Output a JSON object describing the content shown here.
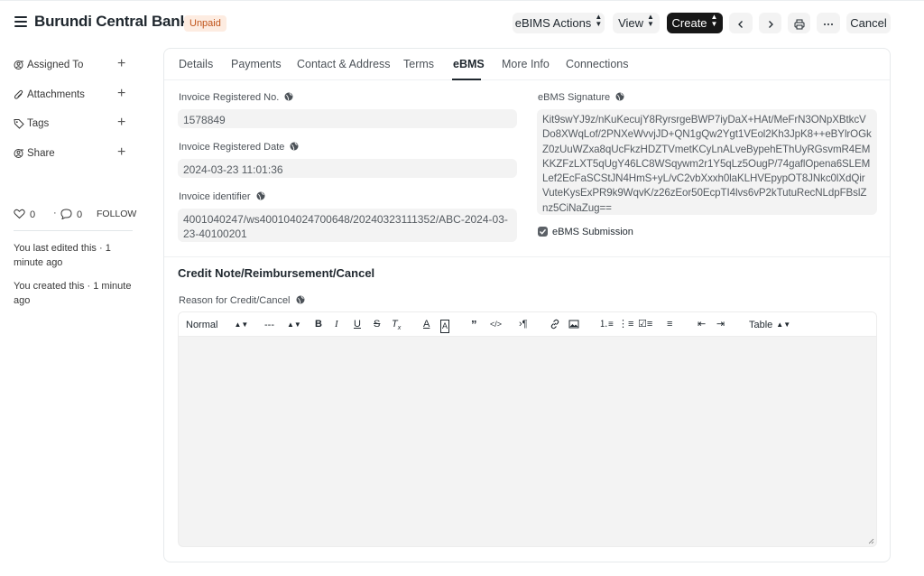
{
  "header": {
    "title": "Burundi Central Bank",
    "status": "Unpaid",
    "buttons": {
      "ebims_actions": "eBIMS Actions",
      "view": "View",
      "create": "Create",
      "cancel": "Cancel"
    }
  },
  "sidebar": {
    "items": [
      {
        "label": "Assigned To",
        "icon": "assign-icon"
      },
      {
        "label": "Attachments",
        "icon": "attachment-icon"
      },
      {
        "label": "Tags",
        "icon": "tag-icon"
      },
      {
        "label": "Share",
        "icon": "share-icon"
      }
    ],
    "likes": "0",
    "comments": "0",
    "follow": "FOLLOW",
    "activity": [
      "You last edited this · 1 minute ago",
      "You created this · 1 minute ago"
    ]
  },
  "tabs": [
    "Details",
    "Payments",
    "Contact & Address",
    "Terms",
    "eBMS",
    "More Info",
    "Connections"
  ],
  "active_tab": "eBMS",
  "fields": {
    "invoice_registered_no": {
      "label": "Invoice Registered No.",
      "value": "1578849"
    },
    "invoice_registered_date": {
      "label": "Invoice Registered Date",
      "value": "2024-03-23 11:01:36"
    },
    "invoice_identifier": {
      "label": "Invoice identifier",
      "value": "4001040247/ws400104024700648/20240323111352/ABC-2024-03-23-40100201"
    },
    "ebms_signature": {
      "label": "eBMS Signature",
      "value": "Kit9swYJ9z/nKuKecujY8RyrsrgeBWP7iyDaX+HAt/MeFrN3ONpXBtkcVDo8XWqLof/2PNXeWvvjJD+QN1gQw2Ygt1VEol2Kh3JpK8++eBYlrOGkZ0zUuWZxa8qUcFkzHDZTVmetKCyLnALveBypehEThUyRGsvmR4EMKKZFzLXT5qUgY46LC8WSqywm2r1Y5qLz5OugP/74gaflOpena6SLEMLef2EcFaSCStJN4HmS+yL/vC2vbXxxh0laKLHVEpypOT8JNkc0lXdQirVuteKysExPR9k9WqvK/z26zEor50EcpTI4lvs6vP2kTutuRecNLdpFBslZnz5CiNaZug=="
    },
    "ebms_submission": {
      "label": "eBMS Submission",
      "checked": true
    }
  },
  "section": {
    "title": "Credit Note/Reimbursement/Cancel",
    "reason_label": "Reason for Credit/Cancel"
  },
  "editor_toolbar": {
    "format": "Normal",
    "size": "---",
    "table": "Table"
  }
}
